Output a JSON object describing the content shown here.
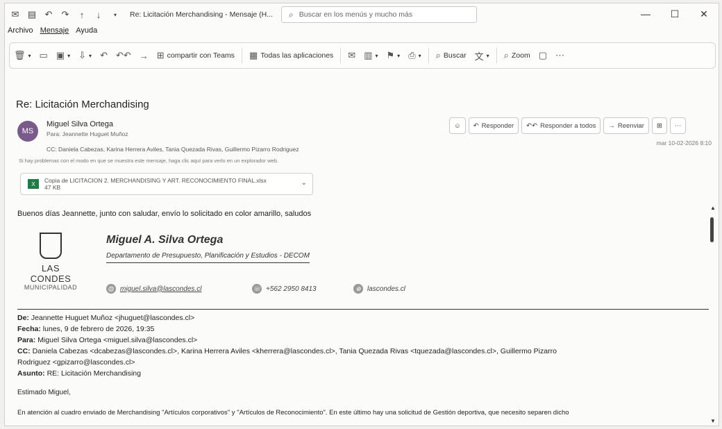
{
  "titlebar": {
    "title": "Re: Licitación Merchandising - Mensaje (H...",
    "search_placeholder": "Buscar en los menús y mucho más"
  },
  "menu": {
    "items": [
      "Archivo",
      "Mensaje",
      "Ayuda"
    ]
  },
  "ribbon": {
    "teams": "compartir con Teams",
    "apps": "Todas las aplicaciones",
    "buscar": "Buscar",
    "zoom": "Zoom"
  },
  "message": {
    "subject": "Re: Licitación Merchandising",
    "avatar_initials": "MS",
    "sender": "Miguel Silva Ortega",
    "para": "Para: Jeannette Huguet Muñoz",
    "cc": "CC: Daniela Cabezas, Karina Herrera Aviles, Tania Quezada Rivas, Guillermo Pizarro Rodriguez",
    "notice": "Si hay problemas con el modo en que se muestra este mensaje, haga clic aquí para verlo en un explorador web.",
    "attachment_name": "Copia de LICITACION 2. MERCHANDISING Y ART. RECONOCIMIENTO FINAL.xlsx",
    "attachment_size": "47 KB",
    "date": "mar 10-02-2026 8:10",
    "actions": {
      "reply": "Responder",
      "reply_all": "Responder a todos",
      "forward": "Reenviar"
    }
  },
  "body": {
    "greeting": "Buenos días Jeannette, junto con saludar, envío lo solicitado en color amarillo, saludos",
    "signature": {
      "name": "Miguel A. Silva Ortega",
      "dept": "Departamento de Presupuesto, Planificación y Estudios - DECOM",
      "logo_line1": "LAS CONDES",
      "logo_line2": "MUNICIPALIDAD",
      "email": "miguel.silva@lascondes.cl",
      "phone": "+562 2950 8413",
      "web": "lascondes.cl"
    },
    "fwd": {
      "de_label": "De:",
      "de": "Jeannette Huguet Muñoz <jhuguet@lascondes.cl>",
      "fecha_label": "Fecha:",
      "fecha": "lunes, 9 de febrero de 2026, 19:35",
      "para_label": "Para:",
      "para": "Miguel Silva Ortega <miguel.silva@lascondes.cl>",
      "cc_label": "CC:",
      "cc1": "Daniela Cabezas <dcabezas@lascondes.cl>, Karina Herrera Aviles <kherrera@lascondes.cl>, Tania Quezada Rivas <tquezada@lascondes.cl>, Guillermo Pizarro",
      "cc2": "Rodriguez <gpizarro@lascondes.cl>",
      "asunto_label": "Asunto:",
      "asunto": "RE: Licitación Merchandising",
      "saludo": "Estimado Miguel,",
      "parrafo": "En atención al cuadro enviado de Merchandising \"Artículos corporativos\" y \"Artículos de Reconocimiento\". En este último hay una solicitud de Gestión deportiva, que necesito separen dicho"
    }
  }
}
